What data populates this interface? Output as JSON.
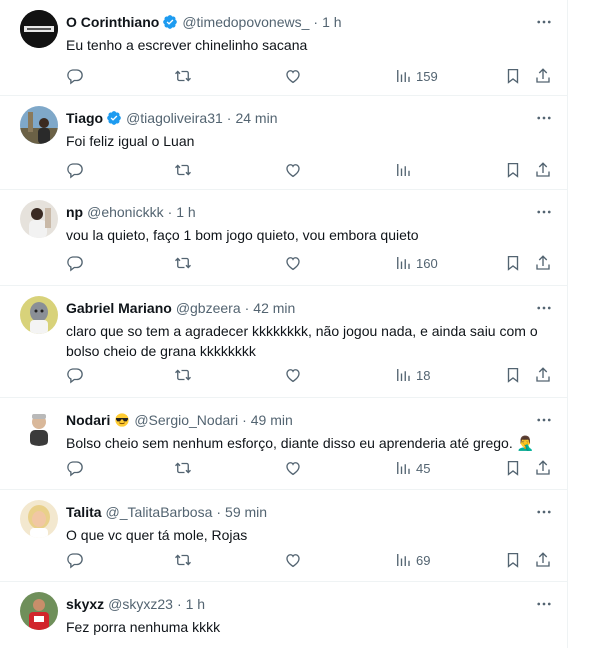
{
  "tweets": [
    {
      "name": "O Corinthiano",
      "verified": true,
      "handle": "@timedopovonews_",
      "time": "1 h",
      "text": "Eu tenho a escrever chinelinho sacana",
      "views": "159",
      "avatar_label": "O CORINTHIANO"
    },
    {
      "name": "Tiago",
      "verified": true,
      "handle": "@tiagoliveira31",
      "time": "24 min",
      "text": "Foi feliz igual o Luan",
      "views": ""
    },
    {
      "name": "np",
      "verified": false,
      "handle": "@ehonickkk",
      "time": "1 h",
      "text": "vou la quieto, faço 1 bom jogo quieto, vou embora quieto",
      "views": "160"
    },
    {
      "name": "Gabriel Mariano",
      "verified": false,
      "handle": "@gbzeera",
      "time": "42 min",
      "text": "claro que so tem a agradecer kkkkkkkk, não jogou nada, e ainda saiu com o bolso cheio de grana kkkkkkkk",
      "views": "18"
    },
    {
      "name": "Nodari",
      "verified": false,
      "name_emoji": "😎",
      "handle": "@Sergio_Nodari",
      "time": "49 min",
      "text": "Bolso cheio sem nenhum esforço, diante disso eu aprenderia até grego. 🤦‍♂️",
      "views": "45"
    },
    {
      "name": "Talita",
      "verified": false,
      "handle": "@_TalitaBarbosa",
      "time": "59 min",
      "text": "O que vc quer tá mole, Rojas",
      "views": "69"
    },
    {
      "name": "skyxz",
      "verified": false,
      "handle": "@skyxz23",
      "time": "1 h",
      "text": "Fez porra nenhuma kkkk",
      "views": ""
    }
  ],
  "separator": "·",
  "colors": {
    "text": "#0f1419",
    "secondary": "#536471",
    "verified": "#1d9bf0",
    "border": "#eff3f4"
  },
  "icons": [
    "more-icon",
    "reply-icon",
    "retweet-icon",
    "like-icon",
    "views-icon",
    "bookmark-icon",
    "share-icon",
    "verified-badge-icon"
  ]
}
